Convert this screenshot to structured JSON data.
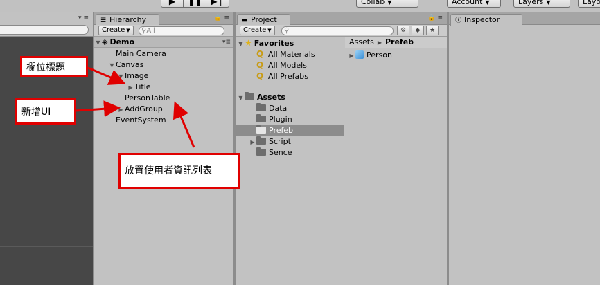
{
  "toolbar": {
    "collab_label": "Collab",
    "account_label": "Account",
    "layers_label": "Layers",
    "layout_label": "Layo",
    "play_icon": "▶",
    "pause_icon": "❚❚",
    "step_icon": "▶❘"
  },
  "scene_panel": {},
  "hierarchy": {
    "tab_label": "Hierarchy",
    "create_label": "Create",
    "search_placeholder": "All",
    "scene_name": "Demo",
    "items": [
      {
        "label": "Main Camera"
      },
      {
        "label": "Canvas"
      },
      {
        "label": "Image"
      },
      {
        "label": "Title"
      },
      {
        "label": "PersonTable"
      },
      {
        "label": "AddGroup"
      },
      {
        "label": "EventSystem"
      }
    ]
  },
  "project": {
    "tab_label": "Project",
    "create_label": "Create",
    "favorites_label": "Favorites",
    "favorites": [
      "All Materials",
      "All Models",
      "All Prefabs"
    ],
    "assets_label": "Assets",
    "folders": [
      "Data",
      "Plugin",
      "Prefeb",
      "Script",
      "Sence"
    ],
    "selected_folder": "Prefeb",
    "breadcrumb_root": "Assets",
    "breadcrumb_current": "Prefeb",
    "files": [
      "Person"
    ]
  },
  "inspector": {
    "tab_label": "Inspector"
  },
  "annotations": {
    "field_title": "欄位標題",
    "add_ui": "新增UI",
    "user_list": "放置使用者資訊列表"
  },
  "colors": {
    "annotation_red": "#e00000",
    "panel_bg": "#c2c2c2",
    "scene_bg": "#474747",
    "selection": "#8c8c8c"
  }
}
